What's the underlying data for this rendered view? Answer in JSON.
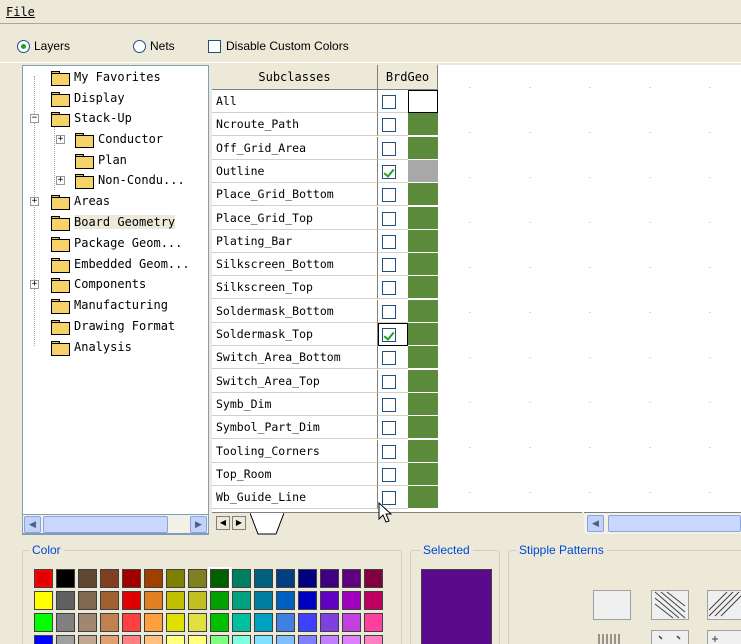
{
  "menu": {
    "file": "File"
  },
  "options": {
    "layers_label": "Layers",
    "nets_label": "Nets",
    "disable_custom_colors_label": "Disable Custom Colors"
  },
  "tree": {
    "items": [
      {
        "label": "My Favorites"
      },
      {
        "label": "Display"
      },
      {
        "label": "Stack-Up"
      },
      {
        "label": "Conductor"
      },
      {
        "label": "Plan"
      },
      {
        "label": "Non-Condu..."
      },
      {
        "label": "Areas"
      },
      {
        "label": "Board Geometry"
      },
      {
        "label": "Package Geom..."
      },
      {
        "label": "Embedded Geom..."
      },
      {
        "label": "Components"
      },
      {
        "label": "Manufacturing"
      },
      {
        "label": "Drawing Format"
      },
      {
        "label": "Analysis"
      }
    ]
  },
  "grid": {
    "col_subclasses": "Subclasses",
    "col_brdgeo": "BrdGeo",
    "rows": [
      {
        "name": "All",
        "checked": false
      },
      {
        "name": "Ncroute_Path",
        "checked": false
      },
      {
        "name": "Off_Grid_Area",
        "checked": false
      },
      {
        "name": "Outline",
        "checked": true
      },
      {
        "name": "Place_Grid_Bottom",
        "checked": false
      },
      {
        "name": "Place_Grid_Top",
        "checked": false
      },
      {
        "name": "Plating_Bar",
        "checked": false
      },
      {
        "name": "Silkscreen_Bottom",
        "checked": false
      },
      {
        "name": "Silkscreen_Top",
        "checked": false
      },
      {
        "name": "Soldermask_Bottom",
        "checked": false
      },
      {
        "name": "Soldermask_Top",
        "checked": true
      },
      {
        "name": "Switch_Area_Bottom",
        "checked": false
      },
      {
        "name": "Switch_Area_Top",
        "checked": false
      },
      {
        "name": "Symb_Dim",
        "checked": false
      },
      {
        "name": "Symbol_Part_Dim",
        "checked": false
      },
      {
        "name": "Tooling_Corners",
        "checked": false
      },
      {
        "name": "Top_Room",
        "checked": false
      },
      {
        "name": "Wb_Guide_Line",
        "checked": false
      }
    ]
  },
  "color_panel": {
    "title": "Color",
    "palette": [
      [
        "#e00000",
        "#000000",
        "#604830",
        "#804020",
        "#a00000",
        "#a04000",
        "#808000",
        "#808020",
        "#006000",
        "#008060",
        "#006080",
        "#004080",
        "#000080",
        "#400080",
        "#600080",
        "#800040"
      ],
      [
        "#ffff00",
        "#606060",
        "#806850",
        "#a06030",
        "#e00000",
        "#e08020",
        "#c0c000",
        "#c0c020",
        "#00a000",
        "#00a080",
        "#0080a0",
        "#0060c0",
        "#0000c0",
        "#6000c0",
        "#a000c0",
        "#c00060"
      ],
      [
        "#00ff00",
        "#808080",
        "#a08870",
        "#c08050",
        "#ff4040",
        "#ffa040",
        "#e0e000",
        "#e0e040",
        "#00c000",
        "#00c0a0",
        "#00a0c0",
        "#4080e0",
        "#4040ff",
        "#8040e0",
        "#c040e0",
        "#ff40a0"
      ],
      [
        "#0000ff",
        "#a0a0a0",
        "#c0a890",
        "#e0a070",
        "#ff8080",
        "#ffc080",
        "#ffff80",
        "#ffff80",
        "#80ff80",
        "#80ffe0",
        "#80e0ff",
        "#80c0ff",
        "#8080ff",
        "#c080ff",
        "#e080ff",
        "#ff80c0"
      ]
    ]
  },
  "selected_panel": {
    "title": "Selected",
    "color": "#5a0a8a"
  },
  "stipple_panel": {
    "title": "Stipple Patterns"
  },
  "colors": {
    "grid_color": "#5a8a3a",
    "outline_color": "#a8a8a8",
    "accent": "#0046d5"
  }
}
